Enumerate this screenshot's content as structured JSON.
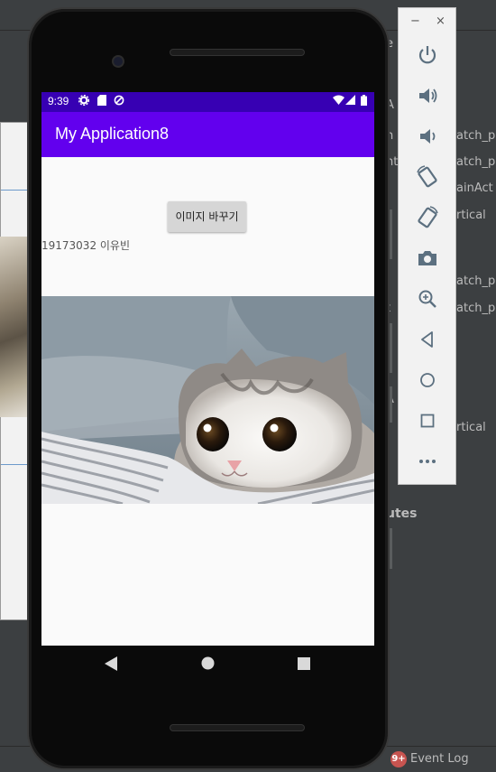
{
  "ide": {
    "properties": [
      {
        "key": "e",
        "value": "",
        "field": false
      },
      {
        "key": "",
        "value": "",
        "field": false
      },
      {
        "key": "A",
        "value": "",
        "field": false
      },
      {
        "key": "h",
        "value": "atch_pa",
        "field": false
      },
      {
        "key": "nt",
        "value": "atch_pa",
        "field": false
      },
      {
        "key": "",
        "value": "ainAct",
        "field": false
      },
      {
        "key": "",
        "value": "rtical",
        "field": false
      },
      {
        "key": "",
        "value": "",
        "field": false
      },
      {
        "key": "",
        "value": "atch_pa",
        "field": false
      },
      {
        "key": "t",
        "value": "atch_pa",
        "field": false
      },
      {
        "key": "A",
        "value": "",
        "field": false
      },
      {
        "key": "",
        "value": "rtical",
        "field": false
      }
    ],
    "section_label": "utes",
    "event_badge": "9+",
    "event_label": "Event Log"
  },
  "device": {
    "status_time": "9:39",
    "app_title": "My Application8",
    "button_label": "이미지 바꾸기",
    "student_label": "19173032 이유빈"
  },
  "emulator": {
    "minimize_label": "−",
    "close_label": "×",
    "tools": [
      "power-icon",
      "volume-up-icon",
      "volume-down-icon",
      "rotate-left-icon",
      "rotate-right-icon",
      "camera-icon",
      "zoom-icon",
      "back-icon",
      "home-icon",
      "overview-icon",
      "more-icon"
    ]
  },
  "colors": {
    "status_bar": "#3700b3",
    "app_bar": "#6200ee",
    "screen_bg": "#fafafa",
    "ide_bg": "#3c3f41",
    "toolbar_icon": "#5c7080"
  }
}
